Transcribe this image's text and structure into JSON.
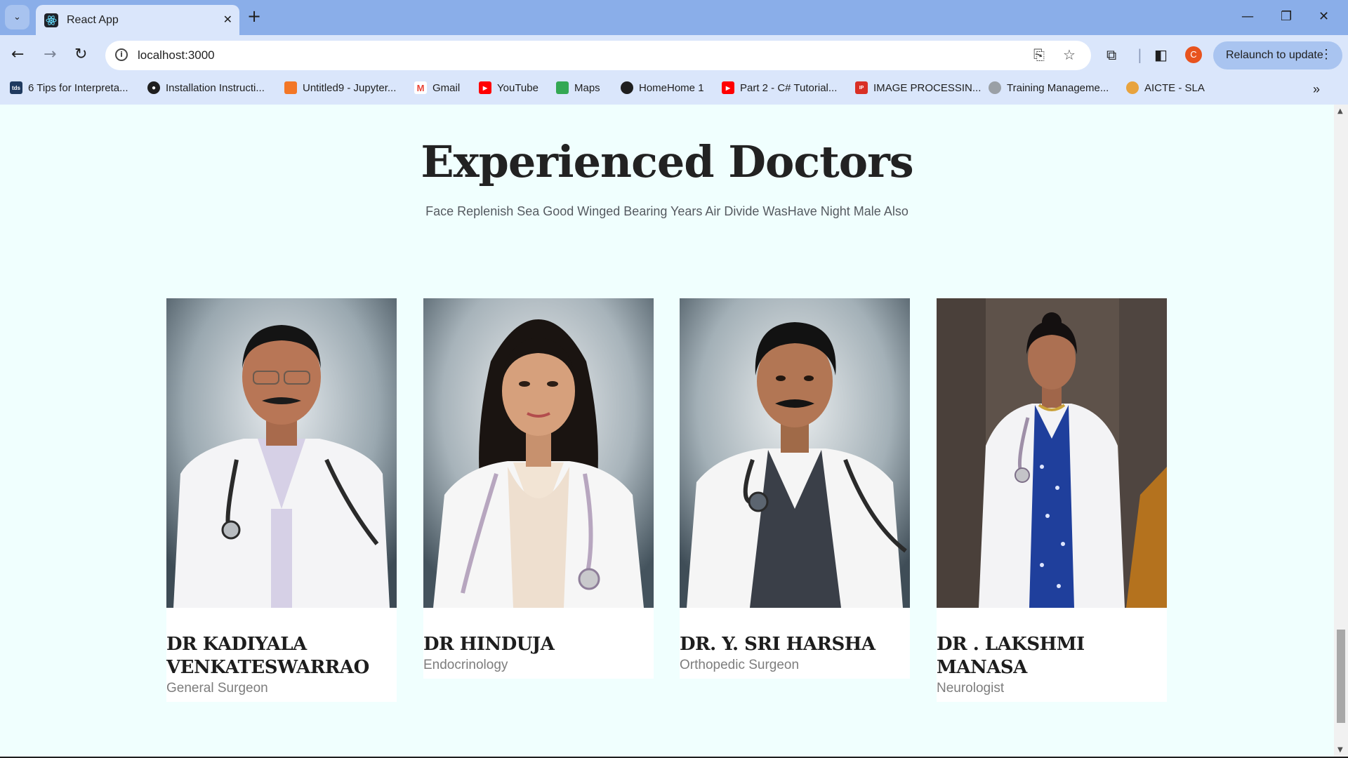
{
  "browser": {
    "tab_title": "React App",
    "url": "localhost:3000",
    "relaunch_label": "Relaunch to update",
    "avatar_letter": "C",
    "bookmarks": [
      {
        "label": "6 Tips for Interpreta...",
        "icon": "tds-icon",
        "color": "#1f3a5f"
      },
      {
        "label": "Installation Instructi...",
        "icon": "github-icon",
        "color": "#1f1f1f"
      },
      {
        "label": "Untitled9 - Jupyter...",
        "icon": "jupyter-icon",
        "color": "#f37726"
      },
      {
        "label": "Gmail",
        "icon": "gmail-icon",
        "color": "#ea4335"
      },
      {
        "label": "YouTube",
        "icon": "youtube-icon",
        "color": "#ff0000"
      },
      {
        "label": "Maps",
        "icon": "maps-icon",
        "color": "#34a853"
      },
      {
        "label": "HomeHome 1",
        "icon": "globe-icon",
        "color": "#1f1f1f"
      },
      {
        "label": "Part 2 - C# Tutorial...",
        "icon": "youtube-icon",
        "color": "#ff0000"
      },
      {
        "label": "IMAGE PROCESSIN...",
        "icon": "image-icon",
        "color": "#d93025"
      },
      {
        "label": "Training Manageme...",
        "icon": "training-icon",
        "color": "#9aa0a6"
      },
      {
        "label": "AICTE - SLA",
        "icon": "aicte-icon",
        "color": "#e8a33d"
      }
    ]
  },
  "section": {
    "title": "Experienced Doctors",
    "subtitle": "Face Replenish Sea Good Winged Bearing Years Air Divide WasHave Night Male Also"
  },
  "doctors": [
    {
      "name": "DR KADIYALA VENKATESWARRAO",
      "specialty": "General Surgeon"
    },
    {
      "name": "DR HINDUJA",
      "specialty": "Endocrinology"
    },
    {
      "name": "DR. Y. SRI HARSHA",
      "specialty": "Orthopedic Surgeon"
    },
    {
      "name": "DR . LAKSHMI MANASA",
      "specialty": "Neurologist"
    }
  ]
}
